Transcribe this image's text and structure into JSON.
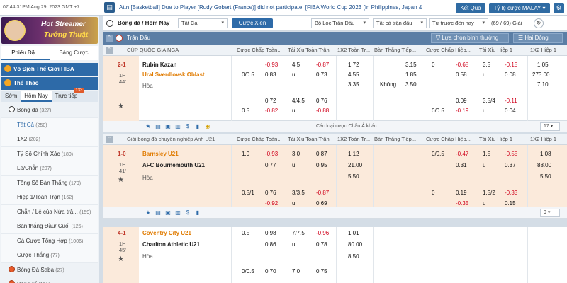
{
  "topbar": {
    "clock": "07:44:31PM Aug 29, 2023 GMT +7",
    "ticker": "Attn:[Basketball] Due to Player [Rudy Gobert (France)] did not participate, [FIBA World Cup 2023 (in Philippines, Japan &",
    "result_button": "Kết Quả",
    "odds_button": "Tỷ lệ cược MALAY",
    "news_icon": "megaphone-icon",
    "settings_icon": "gear-icon"
  },
  "sidebar": {
    "banner_line1": "Hot Streamer",
    "banner_line2": "Tướng Thuật",
    "tabs": [
      "Phiếu Đặ...",
      "Bảng Cược"
    ],
    "section1": "Vô Địch Thế Giới FIBA",
    "section2": "Thể Thao",
    "sub_tabs": [
      "Sớm",
      "Hôm Nay",
      "Trực tiếp"
    ],
    "live_badge": "133",
    "items": [
      {
        "label": "Bóng đá",
        "count": "(327)",
        "type": "cat"
      },
      {
        "label": "Tất Cả",
        "count": "(250)",
        "type": "selected"
      },
      {
        "label": "1X2",
        "count": "(202)",
        "type": "item"
      },
      {
        "label": "Tỷ Số Chính Xác",
        "count": "(180)",
        "type": "item"
      },
      {
        "label": "Lẻ/Chẵn",
        "count": "(207)",
        "type": "item"
      },
      {
        "label": "Tổng Số Bàn Thắng",
        "count": "(179)",
        "type": "item"
      },
      {
        "label": "Hiệp 1/Toàn Trận",
        "count": "(162)",
        "type": "item"
      },
      {
        "label": "Chẵn / Lẻ của Nửa trậ...",
        "count": "(159)",
        "type": "item"
      },
      {
        "label": "Bàn thắng Đầu/ Cuối",
        "count": "(125)",
        "type": "item"
      },
      {
        "label": "Cá Cược Tổng Hợp",
        "count": "(1006)",
        "type": "item"
      },
      {
        "label": "Cược Thắng",
        "count": "(77)",
        "type": "item"
      },
      {
        "label": "Bóng Đá Saba",
        "count": "(27)",
        "type": "cat-red"
      },
      {
        "label": "Bóng rổ",
        "count": "(121)",
        "type": "cat-red"
      }
    ]
  },
  "filterbar": {
    "title": "Bóng đá / Hôm Nay",
    "select_all": "Tất Cả",
    "parlay": "Cược Xiên",
    "league_filter": "Bộ Lọc Trận Đấu",
    "all_bets": "Tất cả trận đấu",
    "sort": "Từ trước đến nay",
    "page_indicator": "(69 / 69) Giải"
  },
  "section": {
    "label": "Trận Đấu",
    "view_select": "Lựa chọn bình thường",
    "layout_select": "Hai Dòng"
  },
  "columns": [
    "Cược Chấp Toàn...",
    "Tài Xỉu Toàn Trận",
    "1X2 Toàn Tr...",
    "Bàn Thắng Tiếp...",
    "Cược Chấp Hiệp...",
    "Tài Xỉu Hiệp 1",
    "1X2 Hiệp 1"
  ],
  "leagues": [
    {
      "name": "CÚP QUỐC GIA NGA",
      "score": "2-1",
      "half": "1H",
      "minute": "44'",
      "home": "Rubin Kazan",
      "away": "Ural Sverdlovsk Oblast",
      "draw": "Hòa",
      "lines": [
        {
          "hdp": "",
          "hdp_h": "-0.93",
          "hdp_a": "0.83",
          "hdp_a_line": "0/0.5",
          "ou": "4.5",
          "ou_h": "-0.87",
          "ou_u": "u",
          "ou_a": "0.73",
          "x1": "1.72",
          "x2": "4.55",
          "xd": "3.35",
          "nx_h": "3.15",
          "nx_a": "1.85",
          "nx_lbl": "Không ...",
          "nx_d": "3.50",
          "h1_hdp": "0",
          "h1_h": "-0.68",
          "h1_a": "0.58",
          "h1_ou": "3.5",
          "h1_ouh": "-0.15",
          "h1_oua": "0.08",
          "h1_1": "1.05",
          "h1_2": "273.00",
          "h1_d": "7.10"
        },
        {
          "hdp_h": "0.72",
          "hdp_a": "-0.82",
          "hdp_a_line": "0.5",
          "ou": "4/4.5",
          "ou_h": "0.76",
          "ou_a": "-0.88",
          "h1_h": "0.09",
          "h1_a": "-0.19",
          "h1_a_line": "0/0.5",
          "h1_ou": "3.5/4",
          "h1_ouh": "-0.11",
          "h1_oua": "0.04"
        }
      ],
      "more": "Các loại cược Châu Á khác",
      "page": "17"
    },
    {
      "name": "Giải bóng đá chuyên nghiệp Anh U21",
      "score": "1-0",
      "half": "1H",
      "minute": "41'",
      "home": "Barnsley U21",
      "away": "AFC Bournemouth U21",
      "draw": "Hòa",
      "lines": [
        {
          "hdp_line": "1.0",
          "hdp_h": "-0.93",
          "hdp_a": "0.77",
          "ou": "3.0",
          "ou_h": "0.87",
          "ou_a": "0.95",
          "x1": "1.12",
          "x2": "21.00",
          "xd": "5.50",
          "h1_hdp": "0/0.5",
          "h1_h": "-0.47",
          "h1_a": "0.31",
          "h1_ou": "1.5",
          "h1_ouh": "-0.55",
          "h1_oua": "0.37",
          "h1_1": "1.08",
          "h1_2": "88.00",
          "h1_d": "5.50"
        },
        {
          "hdp_line": "0.5/1",
          "hdp_h": "0.76",
          "hdp_a": "-0.92",
          "ou": "3/3.5",
          "ou_h": "-0.87",
          "ou_a": "0.69",
          "h1_hdp": "0",
          "h1_h": "0.19",
          "h1_a": "-0.35",
          "h1_ou": "1.5/2",
          "h1_ouh": "-0.33",
          "h1_oua": "0.15"
        }
      ],
      "page": "9",
      "match2": {
        "score": "4-1",
        "half": "1H",
        "minute": "45'",
        "home": "Coventry City U21",
        "away": "Charlton Athletic U21",
        "draw": "Hòa",
        "l1": {
          "hdp_line": "0.5",
          "hdp_h": "0.98",
          "hdp_a": "0.86",
          "ou": "7/7.5",
          "ou_h": "-0.96",
          "ou_a": "0.78",
          "x1": "1.01",
          "x2": "80.00",
          "xd": "8.50"
        },
        "l2": {
          "hdp_line": "0/0.5",
          "hdp_h": "0.70",
          "ou": "7.0",
          "ou_h": "0.75"
        }
      }
    }
  ]
}
